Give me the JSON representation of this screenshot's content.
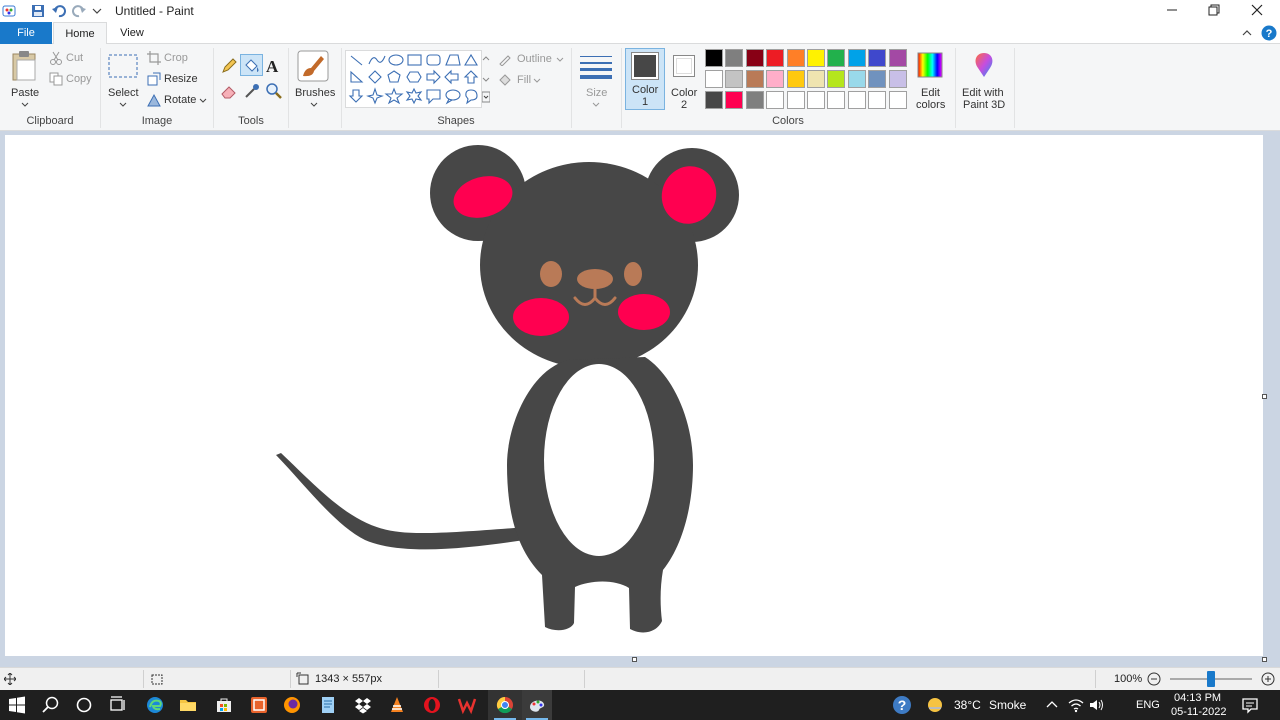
{
  "window": {
    "title": "Untitled - Paint"
  },
  "tabs": [
    {
      "label": "File"
    },
    {
      "label": "Home"
    },
    {
      "label": "View"
    }
  ],
  "clipboard": {
    "paste": "Paste",
    "cut": "Cut",
    "copy": "Copy",
    "group": "Clipboard"
  },
  "image": {
    "select": "Select",
    "crop": "Crop",
    "resize": "Resize",
    "rotate": "Rotate",
    "group": "Image"
  },
  "tools": {
    "group": "Tools"
  },
  "brushes": {
    "label": "Brushes"
  },
  "shapes": {
    "outline": "Outline",
    "fill": "Fill",
    "group": "Shapes"
  },
  "size": {
    "label": "Size"
  },
  "colors": {
    "color1_l1": "Color",
    "color1_l2": "1",
    "color2_l1": "Color",
    "color2_l2": "2",
    "edit_l1": "Edit",
    "edit_l2": "colors",
    "group": "Colors",
    "color1_value": "#474747",
    "color2_value": "#ffffff",
    "palette": [
      "#000000",
      "#7f7f7f",
      "#880015",
      "#ed1c24",
      "#ff7f27",
      "#fff200",
      "#22b14c",
      "#00a2e8",
      "#3f48cc",
      "#a349a4",
      "#ffffff",
      "#c3c3c3",
      "#b97a57",
      "#ffaec9",
      "#ffc90e",
      "#efe4b0",
      "#b5e61d",
      "#99d9ea",
      "#7092be",
      "#c8bfe7",
      "#474747",
      "#ff0050",
      "#7f7f7f",
      "#ffffff",
      "#ffffff",
      "#ffffff",
      "#ffffff",
      "#ffffff",
      "#ffffff",
      "#ffffff"
    ]
  },
  "paint3d": {
    "l1": "Edit with",
    "l2": "Paint 3D"
  },
  "drawing": {
    "body": "#474747",
    "cheeks": "#ff0050",
    "features": "#b97a57"
  },
  "status": {
    "dimensions": "1343 × 557px",
    "zoom": "100%"
  },
  "taskbar": {
    "temp": "38°C",
    "weather": "Smoke",
    "lang": "ENG",
    "time": "04:13 PM",
    "date": "05-11-2022"
  }
}
